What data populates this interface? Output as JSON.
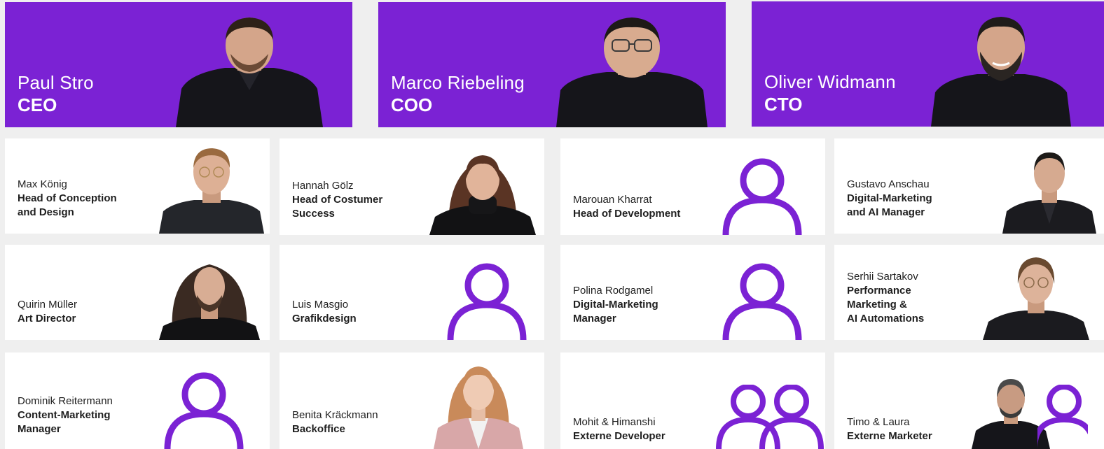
{
  "colors": {
    "accent": "#7b22d4",
    "card_bg": "#ffffff",
    "page_bg": "#efefef"
  },
  "executives": [
    {
      "name": "Paul Stro",
      "role": "CEO"
    },
    {
      "name": "Marco Riebeling",
      "role": "COO"
    },
    {
      "name": "Oliver Widmann",
      "role": "CTO"
    }
  ],
  "team": [
    {
      "name": "Max König",
      "role": "Head of Conception\nand Design",
      "image": "photo"
    },
    {
      "name": "Hannah Gölz",
      "role": "Head of Costumer\nSuccess",
      "image": "photo"
    },
    {
      "name": "Marouan Kharrat",
      "role": "Head of Development",
      "image": "person-placeholder-icon"
    },
    {
      "name": "Gustavo Anschau",
      "role": "Digital-Marketing\nand AI Manager",
      "image": "photo"
    },
    {
      "name": "Quirin Müller",
      "role": "Art Director",
      "image": "photo"
    },
    {
      "name": "Luis Masgio",
      "role": "Grafikdesign",
      "image": "person-placeholder-icon"
    },
    {
      "name": "Polina Rodgamel",
      "role": "Digital-Marketing\nManager",
      "image": "person-placeholder-icon"
    },
    {
      "name": "Serhii Sartakov",
      "role": "Performance\nMarketing &\nAI Automations",
      "image": "photo"
    },
    {
      "name": "Dominik Reitermann",
      "role": "Content-Marketing\nManager",
      "image": "person-placeholder-icon"
    },
    {
      "name": "Benita Kräckmann",
      "role": "Backoffice",
      "image": "photo"
    },
    {
      "name": "Mohit & Himanshi",
      "role": "Externe Developer",
      "image": "two-person-placeholder-icon"
    },
    {
      "name": "Timo & Laura",
      "role": "Externe Marketer",
      "image": "photo-and-person-placeholder-icon"
    }
  ]
}
